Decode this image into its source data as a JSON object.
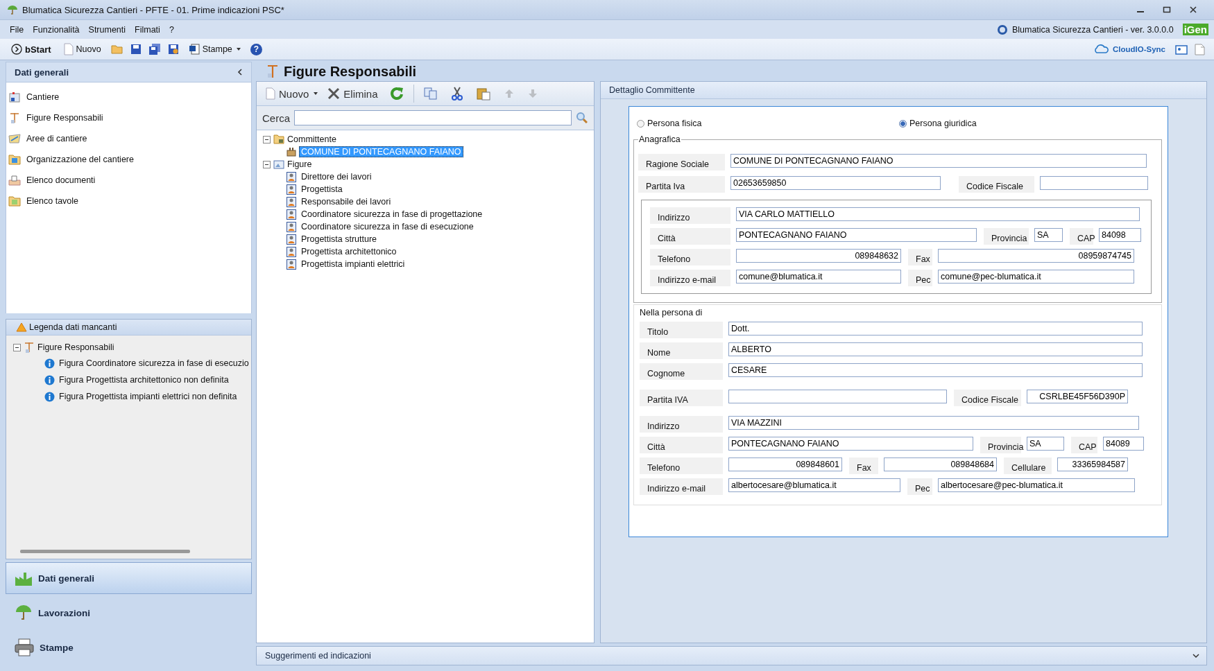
{
  "window": {
    "title": "Blumatica Sicurezza Cantieri - PFTE - 01. Prime indicazioni PSC*",
    "app_version": "Blumatica Sicurezza Cantieri - ver. 3.0.0.0",
    "brand": "iGen"
  },
  "menu": [
    "File",
    "Funzionalità",
    "Strumenti",
    "Filmati",
    "?"
  ],
  "toolbar": {
    "items": [
      {
        "kind": "start",
        "label": "**b**Start"
      },
      {
        "kind": "new",
        "label": "Nuovo"
      },
      {
        "kind": "open"
      },
      {
        "kind": "save"
      },
      {
        "kind": "save_all"
      },
      {
        "kind": "save_as"
      },
      {
        "kind": "print",
        "label": "Stampe"
      },
      {
        "kind": "help",
        "label": "?"
      }
    ],
    "right": [
      {
        "kind": "cloud",
        "label": "CloudIO-Sync"
      },
      {
        "kind": "contact"
      },
      {
        "kind": "export"
      }
    ]
  },
  "sidebar": {
    "title": "Dati generali",
    "items": [
      "Cantiere",
      "Figure Responsabili",
      "Aree di cantiere",
      "Organizzazione del cantiere",
      "Elenco documenti",
      "Elenco tavole"
    ]
  },
  "legend": {
    "title": "Legenda dati mancanti",
    "group": {
      "label": "Figure Responsabili",
      "expanded": true,
      "children": [
        "Figura Coordinatore sicurezza in fase di esecuzio",
        "Figura Progettista architettonico non definita",
        "Figura Progettista impianti elettrici non definita"
      ]
    }
  },
  "sections": [
    {
      "label": "Dati generali",
      "selected": true
    },
    {
      "label": "Lavorazioni",
      "selected": false
    },
    {
      "label": "Stampe",
      "selected": false
    }
  ],
  "panel": {
    "title": "Figure Responsabili",
    "toolbar": [
      {
        "kind": "new",
        "label": "Nuovo",
        "disabled": false
      },
      {
        "kind": "delete",
        "label": "Elimina",
        "disabled": false
      },
      {
        "kind": "refresh",
        "disabled": false
      },
      {
        "kind": "copy",
        "disabled": false
      },
      {
        "kind": "cut",
        "disabled": false
      },
      {
        "kind": "paste",
        "disabled": false
      },
      {
        "kind": "up",
        "disabled": true
      },
      {
        "kind": "down",
        "disabled": true
      }
    ],
    "search": {
      "label": "Cerca"
    },
    "tree": [
      {
        "label": "Committente",
        "expanded": true,
        "children": [
          {
            "label": "COMUNE DI PONTECAGNANO FAIANO",
            "selected": true
          }
        ]
      },
      {
        "label": "Figure",
        "expanded": true,
        "children": [
          {
            "label": "Direttore dei lavori",
            "selected": false
          },
          {
            "label": "Progettista",
            "selected": false
          },
          {
            "label": "Responsabile dei lavori",
            "selected": false
          },
          {
            "label": "Coordinatore sicurezza in fase di progettazione",
            "selected": false
          },
          {
            "label": "Coordinatore sicurezza in fase di esecuzione",
            "selected": false
          },
          {
            "label": "Progettista strutture",
            "selected": false
          },
          {
            "label": "Progettista architettonico",
            "selected": false
          },
          {
            "label": "Progettista impianti elettrici",
            "selected": false
          }
        ]
      }
    ]
  },
  "detail": {
    "title": "Dettaglio Committente",
    "radios": [
      {
        "label": "Persona fisica",
        "selected": false
      },
      {
        "label": "Persona giuridica",
        "selected": true
      }
    ],
    "anagrafica": {
      "legend": "Anagrafica",
      "rows": [
        [
          {
            "label": "Ragione Sociale",
            "value": "COMUNE DI PONTECAGNANO FAIANO",
            "right_aligned": false
          }
        ],
        [
          {
            "label": "Partita Iva",
            "value": "02653659850",
            "right_aligned": false
          },
          {
            "label": "Codice Fiscale"
          }
        ]
      ],
      "address_rows": [
        [
          {
            "label": "Indirizzo",
            "value": "VIA CARLO MATTIELLO",
            "right_aligned": false
          }
        ],
        [
          {
            "label": "Città",
            "value": "PONTECAGNANO FAIANO",
            "right_aligned": false
          },
          {
            "label": "Provincia",
            "value": "SA",
            "right_aligned": false
          },
          {
            "label": "CAP",
            "value": "84098",
            "right_aligned": false
          }
        ],
        [
          {
            "label": "Telefono",
            "value": "089848632",
            "right_aligned": true
          },
          {
            "label": "Fax",
            "value": "08959874745",
            "right_aligned": true
          }
        ],
        [
          {
            "label": "Indirizzo e-mail",
            "value": "comune@blumatica.it",
            "right_aligned": false
          },
          {
            "label": "Pec",
            "value": "comune@pec-blumatica.it",
            "right_aligned": false
          }
        ]
      ]
    },
    "persona": {
      "title": "Nella persona di",
      "rows": [
        [
          {
            "label": "Titolo",
            "value": "Dott.",
            "right_aligned": false
          }
        ],
        [
          {
            "label": "Nome",
            "value": "ALBERTO",
            "right_aligned": false
          }
        ],
        [
          {
            "label": "Cognome",
            "value": "CESARE",
            "right_aligned": false
          }
        ],
        [
          {
            "label": "Partita IVA"
          },
          {
            "label": "Codice Fiscale",
            "value": "CSRLBE45F56D390P",
            "right_aligned": true
          }
        ],
        [
          {
            "label": "Indirizzo",
            "value": "VIA MAZZINI",
            "right_aligned": false
          }
        ],
        [
          {
            "label": "Città",
            "value": "PONTECAGNANO FAIANO",
            "right_aligned": false
          },
          {
            "label": "Provincia",
            "value": "SA",
            "right_aligned": false
          },
          {
            "label": "CAP",
            "value": "84089",
            "right_aligned": false
          }
        ],
        [
          {
            "label": "Telefono",
            "value": "089848601",
            "right_aligned": true
          },
          {
            "label": "Fax",
            "value": "089848684",
            "right_aligned": true
          },
          {
            "label": "Cellulare",
            "value": "33365984587",
            "right_aligned": true
          }
        ],
        [
          {
            "label": "Indirizzo e-mail",
            "value": "albertocesare@blumatica.it",
            "right_aligned": false
          },
          {
            "label": "Pec",
            "value": "albertocesare@pec-blumatica.it",
            "right_aligned": false
          }
        ]
      ]
    }
  },
  "hints": {
    "title": "Suggerimenti ed indicazioni"
  }
}
